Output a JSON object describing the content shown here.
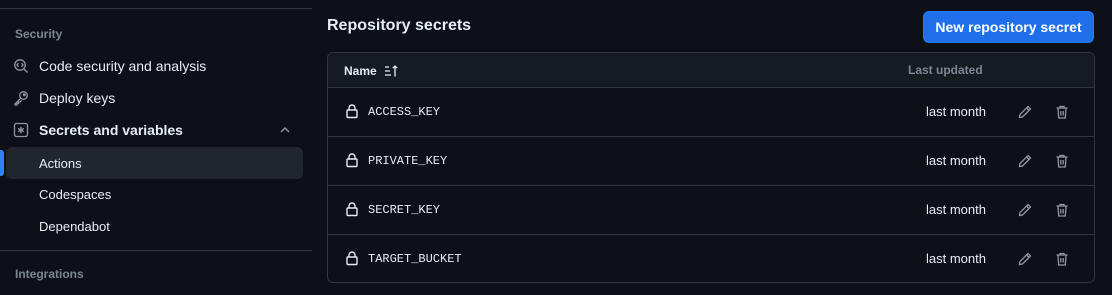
{
  "sidebar": {
    "security_heading": "Security",
    "items": [
      {
        "label": "Code security and analysis",
        "icon": "codescan-icon"
      },
      {
        "label": "Deploy keys",
        "icon": "key-icon"
      },
      {
        "label": "Secrets and variables",
        "icon": "secret-asterisk-icon",
        "expanded": true
      }
    ],
    "sub_items": [
      {
        "label": "Actions",
        "active": true
      },
      {
        "label": "Codespaces",
        "active": false
      },
      {
        "label": "Dependabot",
        "active": false
      }
    ],
    "integrations_heading": "Integrations"
  },
  "main": {
    "title": "Repository secrets",
    "new_button_label": "New repository secret",
    "table": {
      "columns": {
        "name": "Name",
        "last_updated": "Last updated"
      },
      "rows": [
        {
          "name": "ACCESS_KEY",
          "updated": "last month"
        },
        {
          "name": "PRIVATE_KEY",
          "updated": "last month"
        },
        {
          "name": "SECRET_KEY",
          "updated": "last month"
        },
        {
          "name": "TARGET_BUCKET",
          "updated": "last month"
        }
      ]
    }
  },
  "colors": {
    "accent": "#2f81f7",
    "button": "#1f6feb",
    "background": "#0d1117",
    "border": "#30363d"
  }
}
